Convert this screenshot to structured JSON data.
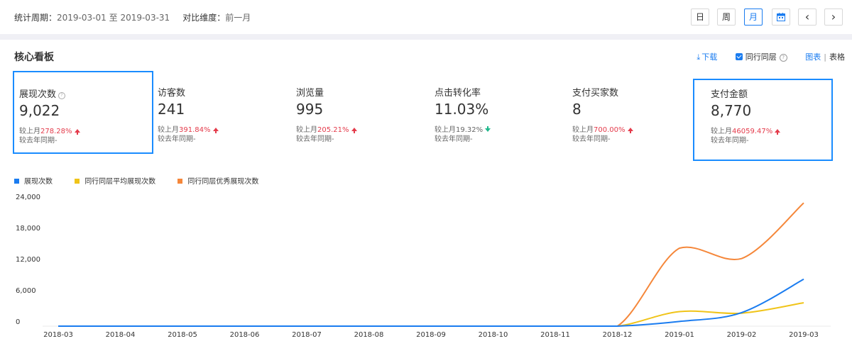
{
  "header": {
    "period_label": "统计周期：",
    "period_start": "2019-03-01",
    "period_to": "至",
    "period_end": "2019-03-31",
    "compare_label": "对比维度：",
    "compare_value": "前一月",
    "buttons": {
      "day": "日",
      "week": "周",
      "month": "月",
      "prev": "‹",
      "next": "›"
    },
    "active_granularity": "month",
    "calendar_icon": "calendar-icon"
  },
  "panel": {
    "title": "核心看板",
    "download": "下载",
    "peer_toggle_label": "同行同层",
    "peer_toggle_checked": true,
    "view_chart": "图表",
    "view_divider": "|",
    "view_table": "表格"
  },
  "metrics": [
    {
      "label": "展现次数",
      "value": "9,022",
      "cmp_prefix": "较上月",
      "cmp_value": "278.28%",
      "trend": "up",
      "yoy": "较去年同期-",
      "has_help": true,
      "selected": true
    },
    {
      "label": "访客数",
      "value": "241",
      "cmp_prefix": "较上月",
      "cmp_value": "391.84%",
      "trend": "up",
      "yoy": "较去年同期-",
      "has_help": false,
      "selected": false
    },
    {
      "label": "浏览量",
      "value": "995",
      "cmp_prefix": "较上月",
      "cmp_value": "205.21%",
      "trend": "up",
      "yoy": "较去年同期-",
      "has_help": false,
      "selected": false
    },
    {
      "label": "点击转化率",
      "value": "11.03%",
      "cmp_prefix": "较上月",
      "cmp_value": "19.32%",
      "trend": "down",
      "yoy": "较去年同期-",
      "has_help": false,
      "selected": false
    },
    {
      "label": "支付买家数",
      "value": "8",
      "cmp_prefix": "较上月",
      "cmp_value": "700.00%",
      "trend": "up",
      "yoy": "较去年同期-",
      "has_help": false,
      "selected": false
    },
    {
      "label": "支付金额",
      "value": "8,770",
      "cmp_prefix": "较上月",
      "cmp_value": "46059.47%",
      "trend": "up",
      "yoy": "较去年同期-",
      "has_help": false,
      "selected": true
    }
  ],
  "chart_data": {
    "type": "line",
    "categories": [
      "2018-03",
      "2018-04",
      "2018-05",
      "2018-06",
      "2018-07",
      "2018-08",
      "2018-09",
      "2018-10",
      "2018-11",
      "2018-12",
      "2019-01",
      "2019-02",
      "2019-03"
    ],
    "yticks": [
      "0",
      "6,000",
      "12,000",
      "18,000",
      "24,000"
    ],
    "ylim": [
      0,
      24000
    ],
    "series": [
      {
        "name": "展现次数",
        "color": "#1a7cf0",
        "values": [
          0,
          0,
          0,
          0,
          0,
          0,
          0,
          0,
          0,
          0,
          900,
          2600,
          9022
        ]
      },
      {
        "name": "同行同层平均展现次数",
        "color": "#f0c419",
        "values": [
          0,
          0,
          0,
          0,
          0,
          0,
          0,
          0,
          0,
          0,
          2800,
          2500,
          4500
        ]
      },
      {
        "name": "同行同层优秀展现次数",
        "color": "#f5873a",
        "values": [
          0,
          0,
          0,
          0,
          0,
          0,
          0,
          0,
          0,
          0,
          15000,
          13000,
          23700
        ]
      }
    ],
    "legend_position": "top-left",
    "grid": false
  }
}
